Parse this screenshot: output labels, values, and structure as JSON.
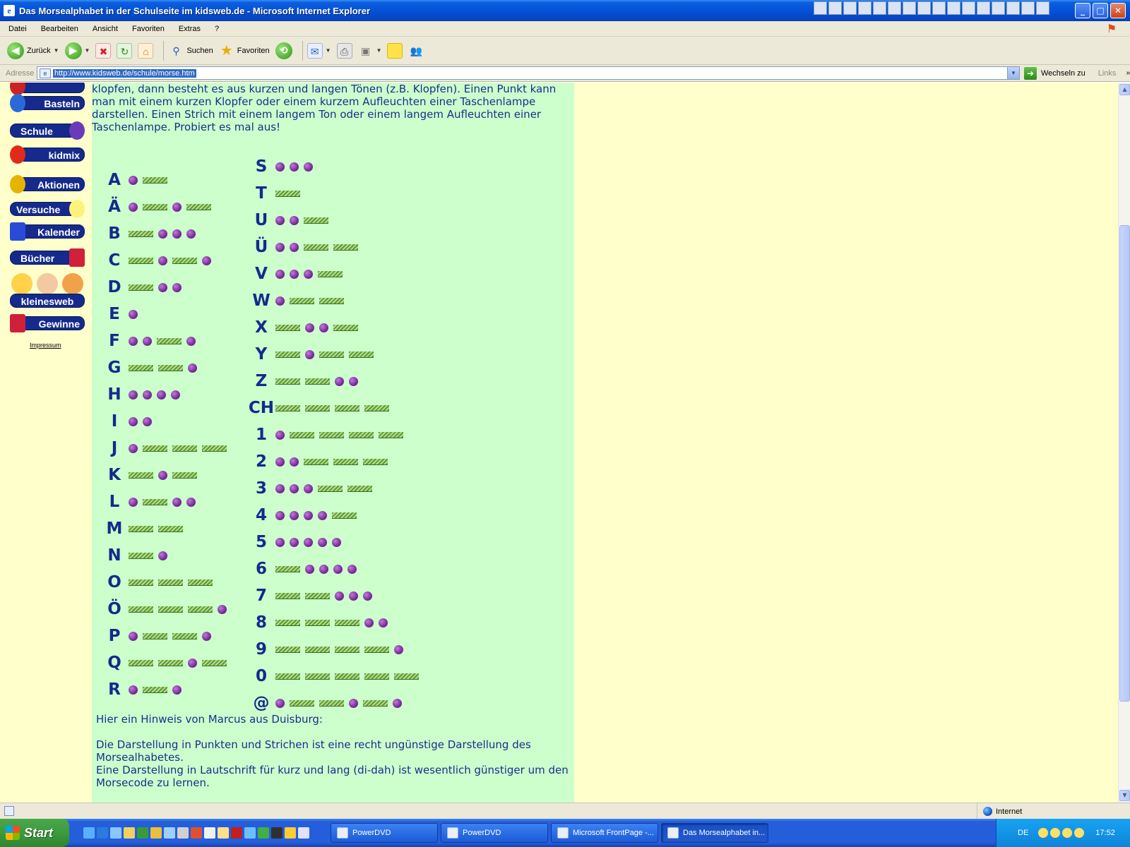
{
  "window": {
    "title": "Das Morsealphabet in der Schulseite im kidsweb.de - Microsoft Internet Explorer"
  },
  "menu": [
    "Datei",
    "Bearbeiten",
    "Ansicht",
    "Favoriten",
    "Extras",
    "?"
  ],
  "toolbar": {
    "back_label": "Zurück",
    "search_label": "Suchen",
    "favorites_label": "Favoriten"
  },
  "address": {
    "label": "Adresse",
    "url": "http://www.kidsweb.de/schule/morse.htm",
    "go_label": "Wechseln zu",
    "links_label": "Links"
  },
  "nav": [
    "Basteln",
    "Schule",
    "kidmix",
    "Aktionen",
    "Versuche",
    "Kalender",
    "Bücher",
    "kleinesweb",
    "Gewinne"
  ],
  "impressum": "Impressum",
  "intro": "klopfen, dann besteht es aus kurzen und langen Tönen (z.B. Klopfen). Einen Punkt kann man mit einem kurzen Klopfer oder einem kurzem Aufleuchten einer Taschenlampe darstellen. Einen Strich mit einem langem Ton oder einem langem Aufleuchten einer Taschenlampe. Probiert es mal aus!",
  "morse_left": [
    {
      "char": "A",
      "code": ".-"
    },
    {
      "char": "Ä",
      "code": ".-.-"
    },
    {
      "char": "B",
      "code": "-..."
    },
    {
      "char": "C",
      "code": "-.-."
    },
    {
      "char": "D",
      "code": "-.."
    },
    {
      "char": "E",
      "code": "."
    },
    {
      "char": "F",
      "code": "..-."
    },
    {
      "char": "G",
      "code": "--."
    },
    {
      "char": "H",
      "code": "...."
    },
    {
      "char": "I",
      "code": ".."
    },
    {
      "char": "J",
      "code": ".---"
    },
    {
      "char": "K",
      "code": "-.-"
    },
    {
      "char": "L",
      "code": ".-.."
    },
    {
      "char": "M",
      "code": "--"
    },
    {
      "char": "N",
      "code": "-."
    },
    {
      "char": "O",
      "code": "---"
    },
    {
      "char": "Ö",
      "code": "---."
    },
    {
      "char": "P",
      "code": ".--."
    },
    {
      "char": "Q",
      "code": "--.-"
    },
    {
      "char": "R",
      "code": ".-."
    }
  ],
  "morse_right": [
    {
      "char": "S",
      "code": "..."
    },
    {
      "char": "T",
      "code": "-"
    },
    {
      "char": "U",
      "code": "..-"
    },
    {
      "char": "Ü",
      "code": "..--"
    },
    {
      "char": "V",
      "code": "...-"
    },
    {
      "char": "W",
      "code": ".--"
    },
    {
      "char": "X",
      "code": "-..-"
    },
    {
      "char": "Y",
      "code": "-.--"
    },
    {
      "char": "Z",
      "code": "--.."
    },
    {
      "char": "CH",
      "code": "----"
    },
    {
      "char": "1",
      "code": ".----"
    },
    {
      "char": "2",
      "code": "..---"
    },
    {
      "char": "3",
      "code": "...--"
    },
    {
      "char": "4",
      "code": "....-"
    },
    {
      "char": "5",
      "code": "....."
    },
    {
      "char": "6",
      "code": "-...."
    },
    {
      "char": "7",
      "code": "--..."
    },
    {
      "char": "8",
      "code": "---.."
    },
    {
      "char": "9",
      "code": "----."
    },
    {
      "char": "0",
      "code": "-----"
    },
    {
      "char": "@",
      "code": ".--.-."
    }
  ],
  "marcus": {
    "heading": "Hier ein Hinweis von Marcus aus Duisburg:",
    "line1": "Die Darstellung in Punkten und Strichen ist eine recht ungünstige Darstellung des Morsealhabetes.",
    "line2": "Eine Darstellung in Lautschrift für kurz und lang (di-dah) ist wesentlich günstiger um den Morsecode zu lernen."
  },
  "status": {
    "zone": "Internet"
  },
  "taskbar": {
    "start": "Start",
    "tasks": [
      "PowerDVD",
      "PowerDVD",
      "Microsoft FrontPage -...",
      "Das Morsealphabet in..."
    ],
    "lang": "DE",
    "clock": "17:52"
  }
}
